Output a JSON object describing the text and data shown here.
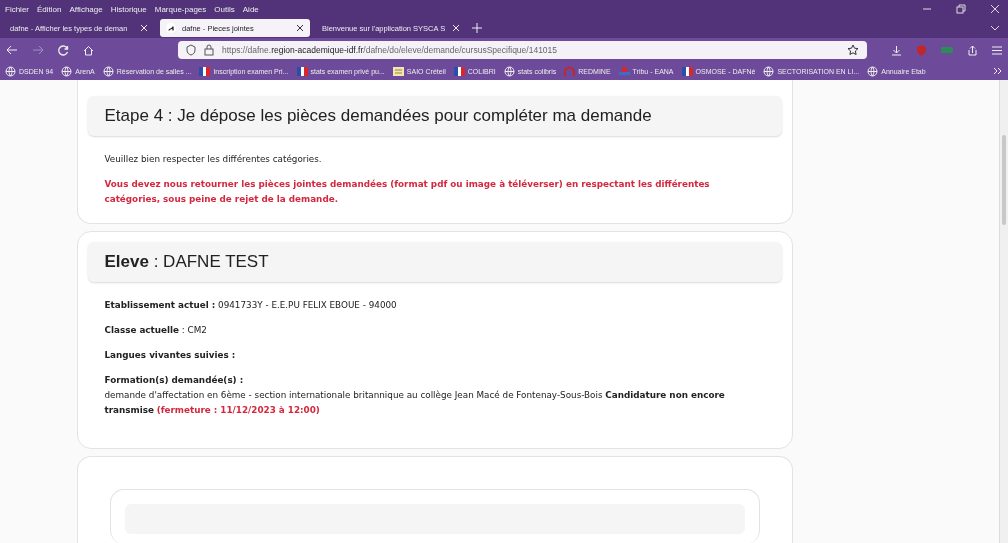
{
  "menu_bar": [
    "Fichier",
    "Édition",
    "Affichage",
    "Historique",
    "Marque-pages",
    "Outils",
    "Aide"
  ],
  "tabs": [
    {
      "label": "dafne - Afficher les types de deman",
      "selected": false
    },
    {
      "label": "dafne - Pieces jointes",
      "selected": true
    },
    {
      "label": "Bienvenue sur l'application SYSCA S",
      "selected": false
    }
  ],
  "address_bar": {
    "prefix": "https://dafne.",
    "domain": "region-academique-idf.fr",
    "path": "/dafne/do/eleve/demande/cursusSpecifique/141015"
  },
  "bookmarks": [
    {
      "label": "DSDEN 94",
      "kind": "globe"
    },
    {
      "label": "ArenA",
      "kind": "globe"
    },
    {
      "label": "Réservation de salles ...",
      "kind": "globe"
    },
    {
      "label": "Inscription examen Pri...",
      "kind": "flag"
    },
    {
      "label": "stats examen privé pu...",
      "kind": "flag"
    },
    {
      "label": "SAIO Créteil",
      "kind": "grid"
    },
    {
      "label": "COLIBRI",
      "kind": "flag"
    },
    {
      "label": "stats colibris",
      "kind": "globe"
    },
    {
      "label": "REDMINE",
      "kind": "arch"
    },
    {
      "label": "Tribu - EANA",
      "kind": "bar"
    },
    {
      "label": "OSMOSE - DAFNé",
      "kind": "flag"
    },
    {
      "label": "SECTORISATION EN LI...",
      "kind": "globe"
    },
    {
      "label": "Annuaire Etab",
      "kind": "globe"
    }
  ],
  "step_card": {
    "title": "Etape 4 : Je dépose les pièces demandées pour compléter ma demande",
    "instruction": "Veuillez bien respecter les différentes catégories.",
    "warning": "Vous devez nous retourner les pièces jointes demandées (format pdf ou image à téléverser) en respectant les différentes catégories, sous peine de rejet de la demande."
  },
  "student_card": {
    "title": "**Eleve** : DAFNE TEST",
    "fields": [
      {
        "text": "**Etablissement actuel :** 0941733Y - E.E.PU FELIX EBOUE - 94000"
      },
      {
        "text": "**Classe actuelle** : CM2"
      },
      {
        "text": "**Langues vivantes suivies :**"
      }
    ],
    "formation": {
      "label": "Formation(s) demandée(s) :",
      "text": "demande d'affectation en 6ème - section internationale britannique au collège Jean Macé de Fontenay-Sous-Bois **Candidature non encore transmise**",
      "deadline": "(fermeture : 11/12/2023 à 12:00)"
    }
  }
}
